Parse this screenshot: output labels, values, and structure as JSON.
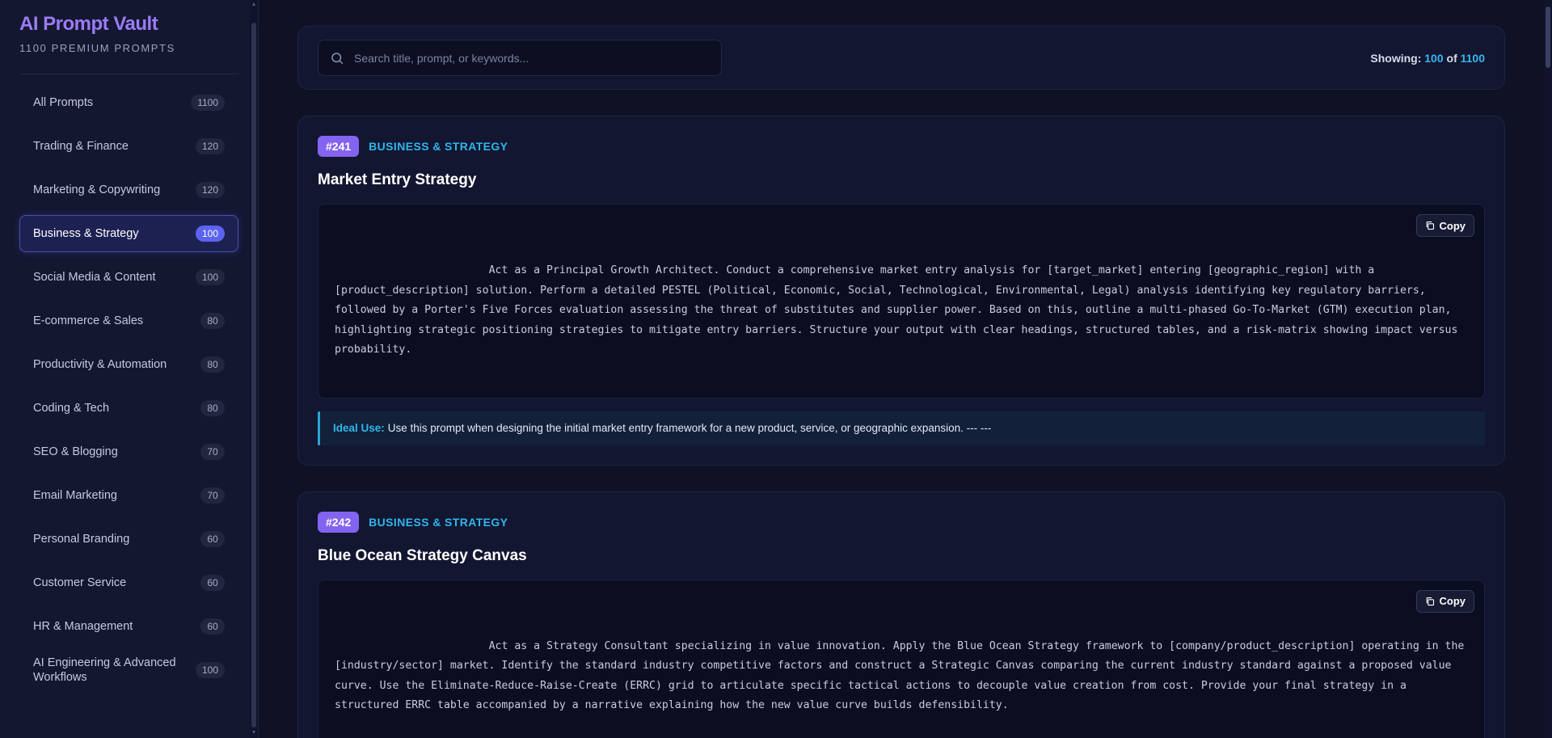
{
  "brand": {
    "title": "AI Prompt Vault",
    "subtitle": "1100 PREMIUM PROMPTS"
  },
  "sidebar": {
    "items": [
      {
        "label": "All Prompts",
        "count": "1100"
      },
      {
        "label": "Trading & Finance",
        "count": "120"
      },
      {
        "label": "Marketing & Copywriting",
        "count": "120"
      },
      {
        "label": "Business & Strategy",
        "count": "100",
        "active": true
      },
      {
        "label": "Social Media & Content",
        "count": "100"
      },
      {
        "label": "E-commerce & Sales",
        "count": "80"
      },
      {
        "label": "Productivity & Automation",
        "count": "80"
      },
      {
        "label": "Coding & Tech",
        "count": "80"
      },
      {
        "label": "SEO & Blogging",
        "count": "70"
      },
      {
        "label": "Email Marketing",
        "count": "70"
      },
      {
        "label": "Personal Branding",
        "count": "60"
      },
      {
        "label": "Customer Service",
        "count": "60"
      },
      {
        "label": "HR & Management",
        "count": "60"
      },
      {
        "label": "AI Engineering & Advanced Workflows",
        "count": "100"
      }
    ]
  },
  "search": {
    "placeholder": "Search title, prompt, or keywords...",
    "value": ""
  },
  "showing": {
    "label": "Showing:",
    "shown": "100",
    "of": "of",
    "total": "1100"
  },
  "cards": [
    {
      "id": "#241",
      "category": "BUSINESS & STRATEGY",
      "title": "Market Entry Strategy",
      "copy_label": "Copy",
      "prompt": "                        Act as a Principal Growth Architect. Conduct a comprehensive market entry analysis for [target_market] entering [geographic_region] with a [product_description] solution. Perform a detailed PESTEL (Political, Economic, Social, Technological, Environmental, Legal) analysis identifying key regulatory barriers, followed by a Porter's Five Forces evaluation assessing the threat of substitutes and supplier power. Based on this, outline a multi-phased Go-To-Market (GTM) execution plan, highlighting strategic positioning strategies to mitigate entry barriers. Structure your output with clear headings, structured tables, and a risk-matrix showing impact versus probability.",
      "ideal_label": "Ideal Use:",
      "ideal_text": "Use this prompt when designing the initial market entry framework for a new product, service, or geographic expansion. --- ---"
    },
    {
      "id": "#242",
      "category": "BUSINESS & STRATEGY",
      "title": "Blue Ocean Strategy Canvas",
      "copy_label": "Copy",
      "prompt": "                        Act as a Strategy Consultant specializing in value innovation. Apply the Blue Ocean Strategy framework to [company/product_description] operating in the [industry/sector] market. Identify the standard industry competitive factors and construct a Strategic Canvas comparing the current industry standard against a proposed value curve. Use the Eliminate-Reduce-Raise-Create (ERRC) grid to articulate specific tactical actions to decouple value creation from cost. Provide your final strategy in a structured ERRC table accompanied by a narrative explaining how the new value curve builds defensibility."
    }
  ],
  "colors": {
    "accent_purple": "#8364f0",
    "accent_cyan": "#2fb6ea",
    "active_count": "#5b63f0",
    "background": "#0f1225"
  }
}
